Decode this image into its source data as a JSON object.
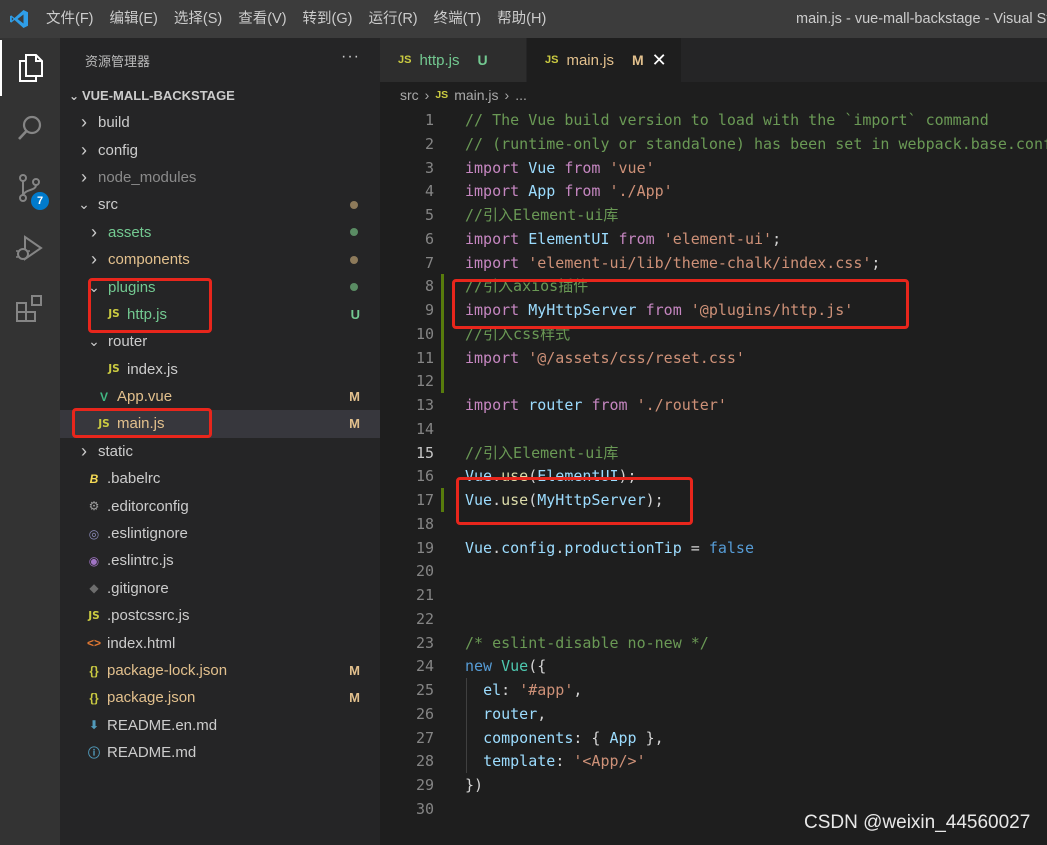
{
  "window": {
    "title": "main.js - vue-mall-backstage - Visual Studio Code",
    "menu": [
      "文件(F)",
      "编辑(E)",
      "选择(S)",
      "查看(V)",
      "转到(G)",
      "运行(R)",
      "终端(T)",
      "帮助(H)"
    ]
  },
  "activity_bar": {
    "items": [
      {
        "name": "explorer",
        "icon": "files-icon",
        "active": true
      },
      {
        "name": "search",
        "icon": "search-icon"
      },
      {
        "name": "source-control",
        "icon": "source-control-icon",
        "badge": "7"
      },
      {
        "name": "run-debug",
        "icon": "run-debug-icon"
      },
      {
        "name": "extensions",
        "icon": "extensions-icon"
      }
    ]
  },
  "sidebar": {
    "header": "资源管理器",
    "more": "···",
    "section": "VUE-MALL-BACKSTAGE",
    "tree": [
      {
        "label": "build",
        "type": "folder",
        "depth": 0,
        "open": false
      },
      {
        "label": "config",
        "type": "folder",
        "depth": 0,
        "open": false
      },
      {
        "label": "node_modules",
        "type": "folder",
        "depth": 0,
        "open": false,
        "dim": true
      },
      {
        "label": "src",
        "type": "folder",
        "depth": 0,
        "open": true,
        "dot": "#8d7a5a"
      },
      {
        "label": "assets",
        "type": "folder",
        "depth": 1,
        "open": false,
        "color": "green",
        "dot": "#5a8c63"
      },
      {
        "label": "components",
        "type": "folder",
        "depth": 1,
        "open": false,
        "color": "mod",
        "dot": "#8d7a5a"
      },
      {
        "label": "plugins",
        "type": "folder",
        "depth": 1,
        "open": true,
        "color": "green",
        "dot": "#5a8c63"
      },
      {
        "label": "http.js",
        "type": "js",
        "depth": 2,
        "color": "green",
        "status": "U"
      },
      {
        "label": "router",
        "type": "folder",
        "depth": 1,
        "open": true
      },
      {
        "label": "index.js",
        "type": "js",
        "depth": 2
      },
      {
        "label": "App.vue",
        "type": "vue",
        "depth": 1,
        "color": "mod",
        "status": "M"
      },
      {
        "label": "main.js",
        "type": "js",
        "depth": 1,
        "color": "mod",
        "status": "M",
        "selected": true
      },
      {
        "label": "static",
        "type": "folder",
        "depth": 0,
        "open": false
      },
      {
        "label": ".babelrc",
        "type": "babel",
        "depth": 0
      },
      {
        "label": ".editorconfig",
        "type": "gear",
        "depth": 0
      },
      {
        "label": ".eslintignore",
        "type": "eslint",
        "depth": 0
      },
      {
        "label": ".eslintrc.js",
        "type": "eslint-js",
        "depth": 0
      },
      {
        "label": ".gitignore",
        "type": "git",
        "depth": 0
      },
      {
        "label": ".postcssrc.js",
        "type": "js",
        "depth": 0
      },
      {
        "label": "index.html",
        "type": "html",
        "depth": 0
      },
      {
        "label": "package-lock.json",
        "type": "json",
        "depth": 0,
        "color": "mod",
        "status": "M"
      },
      {
        "label": "package.json",
        "type": "json",
        "depth": 0,
        "color": "mod",
        "status": "M"
      },
      {
        "label": "README.en.md",
        "type": "md",
        "depth": 0
      },
      {
        "label": "README.md",
        "type": "info",
        "depth": 0
      }
    ]
  },
  "tabs": [
    {
      "icon": "JS",
      "label": "http.js",
      "status": "U",
      "active": false
    },
    {
      "icon": "JS",
      "label": "main.js",
      "status": "M",
      "active": true,
      "close": "✕"
    }
  ],
  "breadcrumb": {
    "folder": "src",
    "icon": "JS",
    "file": "main.js",
    "more": "..."
  },
  "editor": {
    "current_line": 15,
    "lines": [
      [
        [
          "c",
          "// The Vue build version to load with the `import` command"
        ]
      ],
      [
        [
          "c",
          "// (runtime-only or standalone) has been set in webpack.base.conf with an alias."
        ]
      ],
      [
        [
          "k",
          "import"
        ],
        [
          "p",
          " "
        ],
        [
          "v",
          "Vue"
        ],
        [
          "p",
          " "
        ],
        [
          "k",
          "from"
        ],
        [
          "p",
          " "
        ],
        [
          "s",
          "'vue'"
        ]
      ],
      [
        [
          "k",
          "import"
        ],
        [
          "p",
          " "
        ],
        [
          "v",
          "App"
        ],
        [
          "p",
          " "
        ],
        [
          "k",
          "from"
        ],
        [
          "p",
          " "
        ],
        [
          "s",
          "'./App'"
        ]
      ],
      [
        [
          "c",
          "//引入Element-ui库"
        ]
      ],
      [
        [
          "k",
          "import"
        ],
        [
          "p",
          " "
        ],
        [
          "v",
          "ElementUI"
        ],
        [
          "p",
          " "
        ],
        [
          "k",
          "from"
        ],
        [
          "p",
          " "
        ],
        [
          "s",
          "'element-ui'"
        ],
        [
          "p",
          ";"
        ]
      ],
      [
        [
          "k",
          "import"
        ],
        [
          "p",
          " "
        ],
        [
          "s",
          "'element-ui/lib/theme-chalk/index.css'"
        ],
        [
          "p",
          ";"
        ]
      ],
      [
        [
          "c",
          "//引入axios插件"
        ]
      ],
      [
        [
          "k",
          "import"
        ],
        [
          "p",
          " "
        ],
        [
          "v",
          "MyHttpServer"
        ],
        [
          "p",
          " "
        ],
        [
          "k",
          "from"
        ],
        [
          "p",
          " "
        ],
        [
          "s",
          "'@plugins/http.js'"
        ]
      ],
      [
        [
          "c",
          "//引入css样式"
        ]
      ],
      [
        [
          "k",
          "import"
        ],
        [
          "p",
          " "
        ],
        [
          "s",
          "'@/assets/css/reset.css'"
        ]
      ],
      [],
      [
        [
          "k",
          "import"
        ],
        [
          "p",
          " "
        ],
        [
          "v",
          "router"
        ],
        [
          "p",
          " "
        ],
        [
          "k",
          "from"
        ],
        [
          "p",
          " "
        ],
        [
          "s",
          "'./router'"
        ]
      ],
      [],
      [
        [
          "c",
          "//引入Element-ui库"
        ]
      ],
      [
        [
          "v",
          "Vue"
        ],
        [
          "p",
          "."
        ],
        [
          "f",
          "use"
        ],
        [
          "p",
          "("
        ],
        [
          "v",
          "ElementUI"
        ],
        [
          "p",
          ");"
        ]
      ],
      [
        [
          "v",
          "Vue"
        ],
        [
          "p",
          "."
        ],
        [
          "f",
          "use"
        ],
        [
          "p",
          "("
        ],
        [
          "v",
          "MyHttpServer"
        ],
        [
          "p",
          ");"
        ]
      ],
      [],
      [
        [
          "v",
          "Vue"
        ],
        [
          "p",
          "."
        ],
        [
          "v",
          "config"
        ],
        [
          "p",
          "."
        ],
        [
          "v",
          "productionTip"
        ],
        [
          "p",
          " = "
        ],
        [
          "b",
          "false"
        ]
      ],
      [],
      [],
      [],
      [
        [
          "c",
          "/* eslint-disable no-new */"
        ]
      ],
      [
        [
          "b",
          "new"
        ],
        [
          "p",
          " "
        ],
        [
          "t",
          "Vue"
        ],
        [
          "p",
          "({"
        ]
      ],
      [
        [
          "p",
          "  "
        ],
        [
          "v",
          "el"
        ],
        [
          "p",
          ": "
        ],
        [
          "s",
          "'#app'"
        ],
        [
          "p",
          ","
        ]
      ],
      [
        [
          "p",
          "  "
        ],
        [
          "v",
          "router"
        ],
        [
          "p",
          ","
        ]
      ],
      [
        [
          "p",
          "  "
        ],
        [
          "v",
          "components"
        ],
        [
          "p",
          ": { "
        ],
        [
          "v",
          "App"
        ],
        [
          "p",
          " },"
        ]
      ],
      [
        [
          "p",
          "  "
        ],
        [
          "v",
          "template"
        ],
        [
          "p",
          ": "
        ],
        [
          "s",
          "'<App/>'"
        ]
      ],
      [
        [
          "p",
          "})"
        ]
      ],
      []
    ]
  },
  "watermark": "CSDN @weixin_44560027"
}
